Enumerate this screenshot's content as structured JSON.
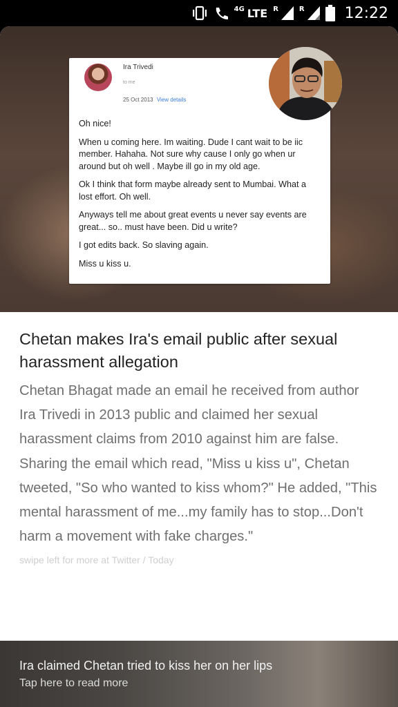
{
  "status_bar": {
    "network_4g": "4G",
    "network_lte": "LTE",
    "roaming_1": "R",
    "roaming_2": "R",
    "time": "12:22",
    "icons": [
      "vibrate-icon",
      "wifi-calling-icon",
      "signal-icon",
      "battery-icon"
    ]
  },
  "email": {
    "sender": "Ira Trivedi",
    "to": "to me",
    "date": "25 Oct 2013",
    "view_details": "View details",
    "paragraphs": [
      "Oh nice!",
      "When u coming here.  Im waiting. Dude I cant wait to be iic member. Hahaha. Not sure why cause I only go when ur around but oh well . Maybe ill go in my old age.",
      "Ok I think that form maybe already sent to Mumbai. What a lost effort.  Oh well.",
      "Anyways tell me about great events u never say events are great... so.. must have been. Did u write?",
      "I got edits back.  So slaving again.",
      "Miss u kiss u."
    ]
  },
  "article": {
    "headline": "Chetan makes Ira's email public after sexual harassment allegation",
    "summary": "Chetan Bhagat made an email he received from author Ira Trivedi in 2013 public and claimed her sexual harassment claims from 2010 against him are false. Sharing the email which read, \"Miss u kiss u\", Chetan tweeted, \"So who wanted to kiss whom?\" He added, \"This mental harassment of me...my family has to stop...Don't harm a movement with fake charges.\"",
    "source": "swipe left for more at Twitter / Today"
  },
  "footer": {
    "title": "Ira claimed Chetan tried to kiss her on her lips",
    "subtitle": "Tap here to read more"
  }
}
